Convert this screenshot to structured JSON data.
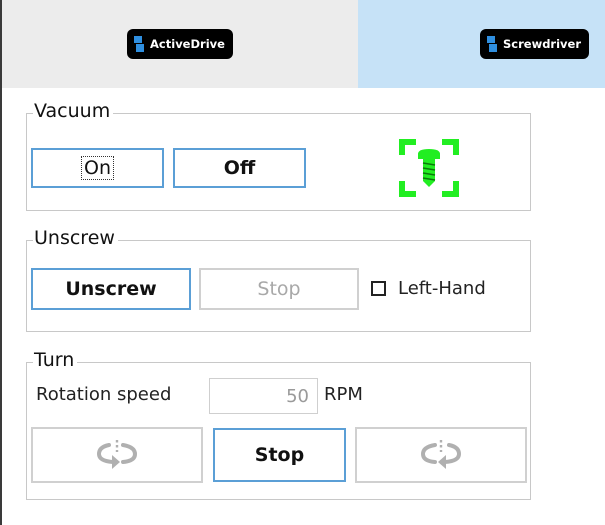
{
  "tabs": [
    {
      "label": "ActiveDrive",
      "icon": "brand-logo-icon"
    },
    {
      "label": "Screwdriver",
      "icon": "brand-logo-icon"
    }
  ],
  "active_tab": "Screwdriver",
  "vacuum": {
    "title": "Vacuum",
    "on_label": "On",
    "off_label": "Off",
    "status_icon": "screw-detected-icon",
    "status_color": "#22ee22"
  },
  "unscrew": {
    "title": "Unscrew",
    "unscrew_label": "Unscrew",
    "stop_label": "Stop",
    "left_hand_label": "Left-Hand",
    "left_hand_checked": false
  },
  "turn": {
    "title": "Turn",
    "speed_label": "Rotation speed",
    "speed_value": "50",
    "speed_unit": "RPM",
    "ccw_icon": "rotate-counterclockwise-icon",
    "stop_label": "Stop",
    "cw_icon": "rotate-clockwise-icon"
  },
  "colors": {
    "accent": "#5b9fd6",
    "active_tab_bg": "#c6e2f7",
    "inactive_tab_bg": "#ececec"
  }
}
